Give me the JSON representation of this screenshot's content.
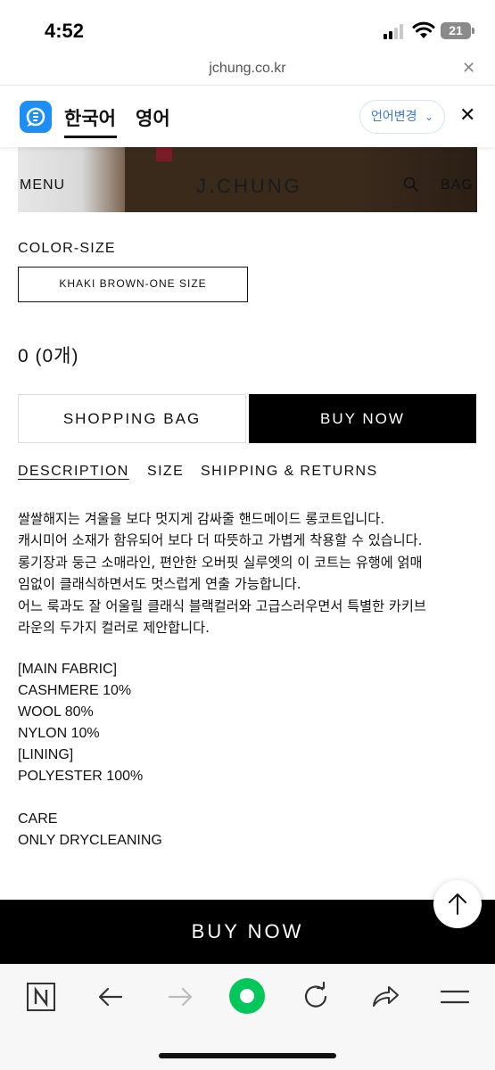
{
  "status": {
    "time": "4:52",
    "battery": "21"
  },
  "browser": {
    "url": "jchung.co.kr"
  },
  "translate": {
    "lang_source": "한국어",
    "lang_target": "영어",
    "change_label": "언어변경"
  },
  "site": {
    "menu_label": "MENU",
    "logo": "J.CHUNG",
    "bag_label": "BAG"
  },
  "product": {
    "color_size_label": "COLOR-SIZE",
    "selected_option": "KHAKI BROWN-ONE SIZE",
    "total": "0 (0개)",
    "shopping_bag_label": "SHOPPING BAG",
    "buy_now_label": "BUY NOW"
  },
  "tabs": [
    {
      "label": "DESCRIPTION",
      "active": true
    },
    {
      "label": "SIZE",
      "active": false
    },
    {
      "label": "SHIPPING & RETURNS",
      "active": false
    }
  ],
  "description": {
    "lines": [
      "쌀쌀해지는 겨울을 보다 멋지게 감싸줄 핸드메이드 롱코트입니다.",
      "캐시미어 소재가 함유되어 보다 더 따뜻하고 가볍게 착용할 수 있습니다.",
      "롱기장과 둥근 소매라인, 편안한 오버핏 실루엣의 이 코트는 유행에 얽매",
      "임없이 클래식하면서도 멋스럽게 연출 가능합니다.",
      "어느 룩과도 잘 어울릴 클래식 블랙컬러와 고급스러우면서 특별한 카키브",
      "라운의 두가지 컬러로 제안합니다."
    ],
    "specs": [
      "[MAIN FABRIC]",
      "CASHMERE 10%",
      "WOOL 80%",
      "NYLON 10%",
      "[LINING]",
      "POLYESTER 100%"
    ],
    "care": [
      "CARE",
      "ONLY DRYCLEANING"
    ]
  },
  "bottom_bar": {
    "buy_now_label": "BUY NOW"
  },
  "toolbar": {
    "icons": [
      "naver-n-icon",
      "back-arrow-icon",
      "forward-arrow-icon",
      "green-dot-icon",
      "reload-icon",
      "share-icon",
      "menu-icon"
    ]
  },
  "colors": {
    "accent_blue": "#3a78d6",
    "papago_blue": "#1d8ef3",
    "green": "#03c75a",
    "black": "#000000"
  }
}
